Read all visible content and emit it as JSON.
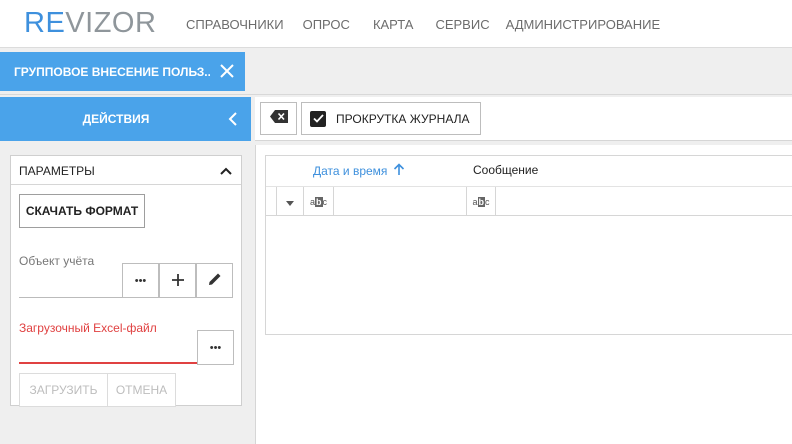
{
  "app": {
    "logo_prefix": "RE",
    "logo_suffix": "VIZOR",
    "accent_color": "#4aa3ea"
  },
  "nav": {
    "items": [
      "СПРАВОЧНИКИ",
      "ОПРОС",
      "КАРТА",
      "СЕРВИС",
      "АДМИНИСТРИРОВАНИЕ"
    ]
  },
  "doc_tab": {
    "label": "ГРУППОВОЕ ВНЕСЕНИЕ ПОЛЬЗ...",
    "close_icon": "close-icon"
  },
  "actions": {
    "label": "ДЕЙСТВИЯ",
    "collapse_icon": "chevron-left-icon"
  },
  "params": {
    "title": "ПАРАМЕТРЫ",
    "toggle_icon": "chevron-up-icon",
    "download_label": "СКАЧАТЬ ФОРМАТ",
    "object_label": "Объект учёта",
    "object_value": "",
    "object_browse": "•••",
    "excel_label": "Загрузочный Excel-файл",
    "excel_value": "",
    "excel_browse": "•••",
    "load_label": "ЗАГРУЗИТЬ",
    "cancel_label": "ОТМЕНА",
    "error_color": "#e04141"
  },
  "toolbar": {
    "clear_icon": "backspace-icon",
    "scroll_label": "ПРОКРУТКА ЖУРНАЛА",
    "scroll_checked": true
  },
  "grid": {
    "columns": [
      {
        "label": "Дата и время",
        "sorted": "asc"
      },
      {
        "label": "Сообщение"
      }
    ],
    "filter_date_value": "",
    "filter_msg_value": "",
    "rows": []
  }
}
